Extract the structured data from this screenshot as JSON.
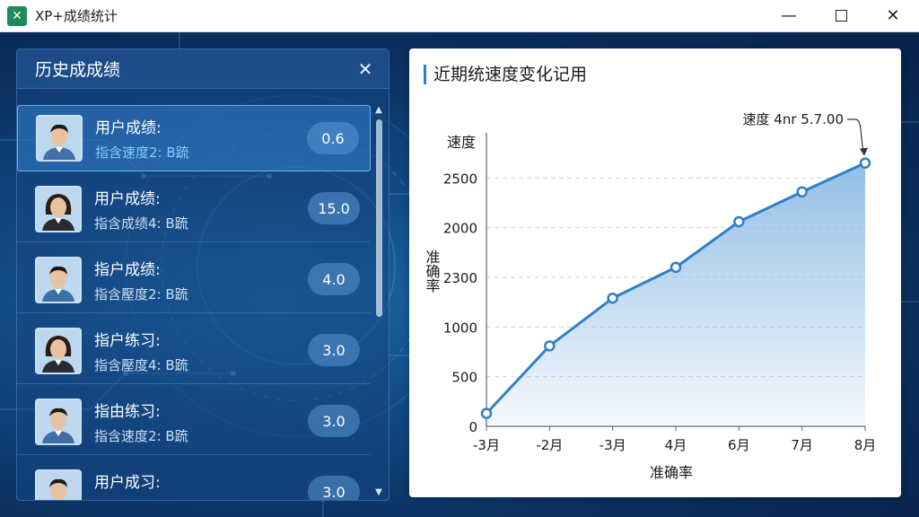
{
  "window": {
    "title": "XP+成绩统计",
    "logo": "logo-icon",
    "controls": [
      "minimize-icon",
      "maximize-icon",
      "close-icon"
    ]
  },
  "left_panel": {
    "title": "历史成成绩",
    "close_icon": "close-icon",
    "items": [
      {
        "name": "用户成绩:",
        "sub": "指含速度2: B䟽",
        "value": "0.6",
        "selected": true,
        "avatar": "male-avatar"
      },
      {
        "name": "用户成绩:",
        "sub": "指含成绩4: B䟽",
        "value": "15.0",
        "selected": false,
        "avatar": "female-avatar"
      },
      {
        "name": "指户成绩:",
        "sub": "指含壓度2: B䟽",
        "value": "4.0",
        "selected": false,
        "avatar": "male-avatar"
      },
      {
        "name": "指户练习:",
        "sub": "指含壓度4: B䟽",
        "value": "3.0",
        "selected": false,
        "avatar": "female-avatar"
      },
      {
        "name": "指由练习:",
        "sub": "指含速度2: B䟽",
        "value": "3.0",
        "selected": false,
        "avatar": "male-avatar"
      },
      {
        "name": "用户成习:",
        "sub": "指含速度2: B䟽",
        "value": "3.0",
        "selected": false,
        "avatar": "male-avatar"
      }
    ]
  },
  "right_panel": {
    "title": "近期统速度变化记用"
  },
  "chart_data": {
    "type": "area",
    "title": "近期统速度变化记用",
    "xlabel": "准确率",
    "ylabel": "准确率",
    "y_top_label": "速度",
    "categories": [
      "-3月",
      "-2月",
      "-3月",
      "4月",
      "6月",
      "7月",
      "8月"
    ],
    "series": [
      {
        "values": [
          130,
          810,
          1290,
          1600,
          2060,
          2360,
          2650
        ]
      }
    ],
    "y_ticks": [
      "0",
      "500",
      "1000",
      "2300",
      "2000",
      "2500"
    ],
    "y_tick_values": [
      0,
      500,
      1000,
      1500,
      2000,
      2500
    ],
    "ylim": [
      0,
      2900
    ],
    "grid": true,
    "annotation": {
      "text": "速度 4nr 5.7.00",
      "point_index": 6
    },
    "colors": {
      "line": "#2f7fc8",
      "fill": "#7fb4e2"
    }
  }
}
